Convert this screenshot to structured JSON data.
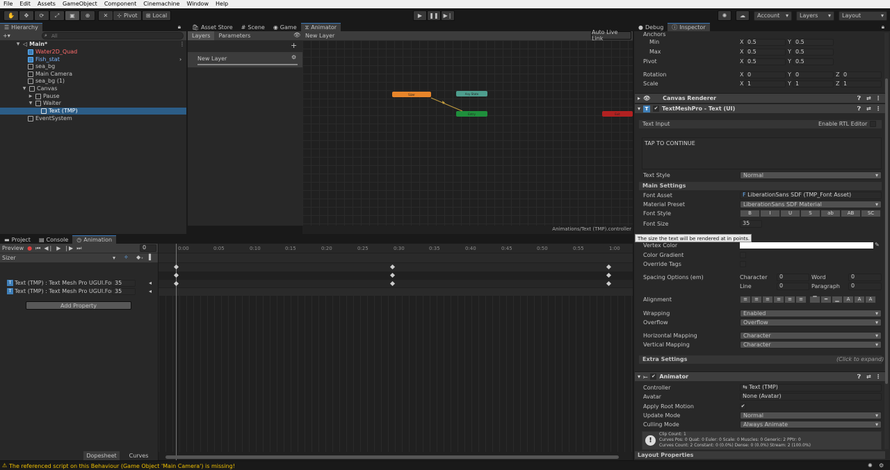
{
  "menu": [
    "File",
    "Edit",
    "Assets",
    "GameObject",
    "Component",
    "Cinemachine",
    "Window",
    "Help"
  ],
  "toolbar": {
    "pivot_label": "Pivot",
    "local_label": "Local",
    "account_label": "Account",
    "layers_label": "Layers",
    "layout_label": "Layout"
  },
  "hierarchy": {
    "tab": "Hierarchy",
    "search_placeholder": "All",
    "items": [
      {
        "label": "Main*"
      },
      {
        "label": "Water2D_Quad"
      },
      {
        "label": "Fish_stat"
      },
      {
        "label": "sea_bg"
      },
      {
        "label": "Main Camera"
      },
      {
        "label": "sea_bg (1)"
      },
      {
        "label": "Canvas"
      },
      {
        "label": "Pause"
      },
      {
        "label": "Waiter"
      },
      {
        "label": "Text (TMP)"
      },
      {
        "label": "EventSystem"
      }
    ]
  },
  "center_tabs": [
    "Asset Store",
    "Scene",
    "Game",
    "Animator"
  ],
  "animator": {
    "layers_tab": "Layers",
    "parameters_tab": "Parameters",
    "breadcrumb": "New Layer",
    "auto_live": "Auto Live Link",
    "layer_name": "New Layer",
    "path": "Animations/Text (TMP).controller",
    "nodes": {
      "state": "Sizer",
      "any": "Any State",
      "entry": "Entry",
      "exit": "Exit"
    }
  },
  "bottom_tabs": [
    "Project",
    "Console",
    "Animation"
  ],
  "animation": {
    "preview": "Preview",
    "frame": "0",
    "clip": "Sizer",
    "ticks": [
      "0:00",
      "0:05",
      "0:10",
      "0:15",
      "0:20",
      "0:25",
      "0:30",
      "0:35",
      "0:40",
      "0:45",
      "0:50",
      "0:55",
      "1:00"
    ],
    "properties": [
      {
        "label": "Text (TMP) : Text Mesh Pro UGUI.For",
        "value": "35"
      },
      {
        "label": "Text (TMP) : Text Mesh Pro UGUI.For",
        "value": "35"
      }
    ],
    "add_property": "Add Property",
    "dopesheet": "Dopesheet",
    "curves": "Curves"
  },
  "inspector_tabs": [
    "Debug",
    "Inspector"
  ],
  "rect": {
    "anchors": "Anchors",
    "min": "Min",
    "max": "Max",
    "pivot": "Pivot",
    "rotation": "Rotation",
    "scale": "Scale",
    "x": "X",
    "y": "Y",
    "z": "Z",
    "min_x": "0.5",
    "min_y": "0.5",
    "max_x": "0.5",
    "max_y": "0.5",
    "pivot_x": "0.5",
    "pivot_y": "0.5",
    "rot_x": "0",
    "rot_y": "0",
    "rot_z": "0",
    "scale_x": "1",
    "scale_y": "1",
    "scale_z": "1"
  },
  "canvas_renderer": "Canvas Renderer",
  "tmp": {
    "title": "TextMeshPro - Text (UI)",
    "text_input": "Text Input",
    "rtl": "Enable RTL Editor",
    "text": "TAP TO CONTINUE",
    "text_style": "Text Style",
    "text_style_val": "Normal",
    "main_settings": "Main Settings",
    "font_asset": "Font Asset",
    "font_asset_val": "LiberationSans SDF (TMP_Font Asset)",
    "material_preset": "Material Preset",
    "material_val": "LiberationSans SDF Material",
    "font_style": "Font Style",
    "styles": [
      "B",
      "I",
      "U",
      "S",
      "ab",
      "AB",
      "SC"
    ],
    "font_size": "Font Size",
    "font_size_val": "35",
    "tooltip": "The size the text will be rendered at in points.",
    "vertex_color": "Vertex Color",
    "color_gradient": "Color Gradient",
    "override_tags": "Override Tags",
    "spacing": "Spacing Options (em)",
    "character": "Character",
    "character_val": "0",
    "word": "Word",
    "word_val": "0",
    "line": "Line",
    "line_val": "0",
    "paragraph": "Paragraph",
    "paragraph_val": "0",
    "alignment": "Alignment",
    "wrapping": "Wrapping",
    "wrapping_val": "Enabled",
    "overflow": "Overflow",
    "overflow_val": "Overflow",
    "hmap": "Horizontal Mapping",
    "hmap_val": "Character",
    "vmap": "Vertical Mapping",
    "vmap_val": "Character",
    "extra": "Extra Settings",
    "extra_hint": "(Click to expand)"
  },
  "animator_comp": {
    "title": "Animator",
    "controller": "Controller",
    "controller_val": "Text (TMP)",
    "avatar": "Avatar",
    "avatar_val": "None (Avatar)",
    "apply_root": "Apply Root Motion",
    "update_mode": "Update Mode",
    "update_mode_val": "Normal",
    "culling": "Culling Mode",
    "culling_val": "Always Animate",
    "info1": "Clip Count: 1",
    "info2": "Curves Pos: 0 Quat: 0 Euler: 0 Scale: 0 Muscles: 0 Generic: 2 PPtr: 0",
    "info3": "Curves Count: 2 Constant: 0 (0.0%) Dense: 0 (0.0%) Stream: 2 (100.0%)"
  },
  "layout_props": "Layout Properties",
  "status": "The referenced script on this Behaviour (Game Object 'Main Camera') is missing!",
  "colors": {
    "accent": "#3a79bb",
    "selection": "#2c5d87",
    "warning": "#f0c000",
    "state_orange": "#e8852a",
    "state_teal": "#4e9e8e",
    "state_green": "#1f8f3c",
    "state_red": "#b22121"
  }
}
